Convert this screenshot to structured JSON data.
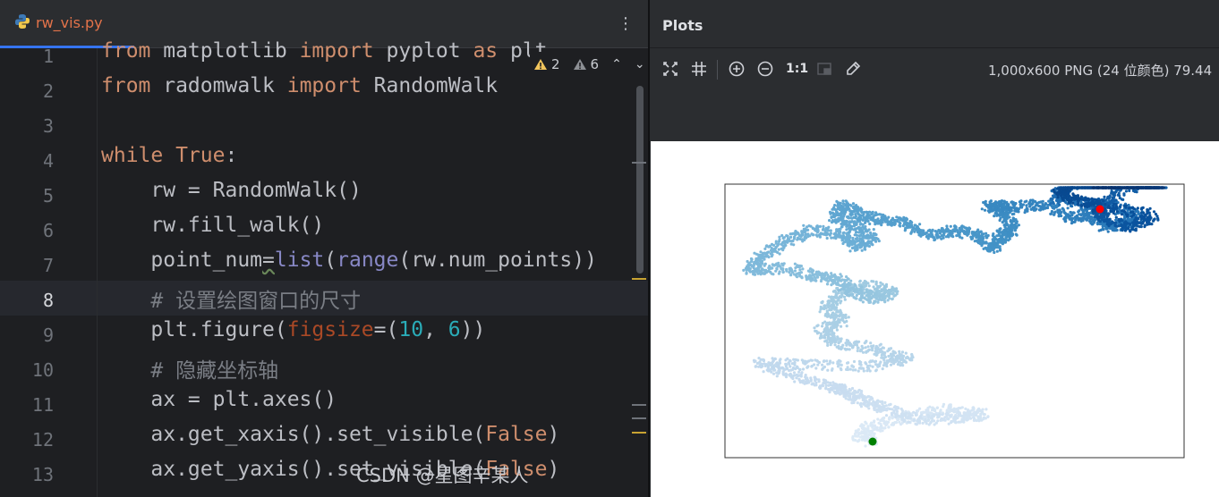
{
  "editor": {
    "tab": {
      "filename": "rw_vis.py"
    },
    "inspections": {
      "warnings": "2",
      "weak_warnings": "6"
    },
    "current_line": "8",
    "line_numbers": [
      "1",
      "2",
      "3",
      "4",
      "5",
      "6",
      "7",
      "8",
      "9",
      "10",
      "11",
      "12",
      "13"
    ],
    "code": {
      "l1": {
        "from": "from",
        "mod": " matplotlib ",
        "imp": "import",
        "name": " pyplot ",
        "as": "as",
        "alias": " plt"
      },
      "l2": {
        "from": "from",
        "mod": " radomwalk ",
        "imp": "import",
        "name": " RandomWalk"
      },
      "l4": {
        "while": "while",
        "sp": " ",
        "true": "True",
        "colon": ":"
      },
      "l5": {
        "text": "    rw = RandomWalk()"
      },
      "l6": {
        "text": "    rw.fill_walk()"
      },
      "l7": {
        "a": "    point_num",
        "eq": "=",
        "list": "list",
        "p1": "(",
        "range": "range",
        "b": "(rw.num_points))"
      },
      "l8": {
        "comment": "    # 设置绘图窗口的尺寸"
      },
      "l9": {
        "a": "    plt.figure(",
        "kw": "figsize",
        "b": "=(",
        "n1": "10",
        "c": ", ",
        "n2": "6",
        "d": "))"
      },
      "l10": {
        "comment": "    # 隐藏坐标轴"
      },
      "l11": {
        "text": "    ax = plt.axes()"
      },
      "l12": {
        "a": "    ax.get_xaxis().set_visible(",
        "f": "False",
        "b": ")"
      },
      "l13": {
        "a": "    ax.get_yaxis().set_visible(",
        "f": "False",
        "b": ")"
      }
    }
  },
  "plots": {
    "title": "Plots",
    "toolbar": {
      "fit_icon": "fit-screen-icon",
      "grid_icon": "grid-icon",
      "zoom_in_icon": "zoom-in-icon",
      "zoom_out_icon": "zoom-out-icon",
      "actual_size_label": "1:1",
      "background_icon": "chessboard-icon",
      "color_picker_icon": "eyedropper-icon"
    },
    "image_info": "1,000x600 PNG (24 位颜色) 79.44"
  },
  "watermark": "CSDN @星图辛某人",
  "colors": {
    "accent": "#3574f0",
    "start_point": "#008000",
    "end_point": "#ff0000",
    "colormap": "Blues"
  },
  "chart_data": {
    "type": "scatter",
    "colormap": "Blues",
    "axes_visible": false,
    "start_point": {
      "color": "green"
    },
    "end_point": {
      "color": "red"
    }
  }
}
